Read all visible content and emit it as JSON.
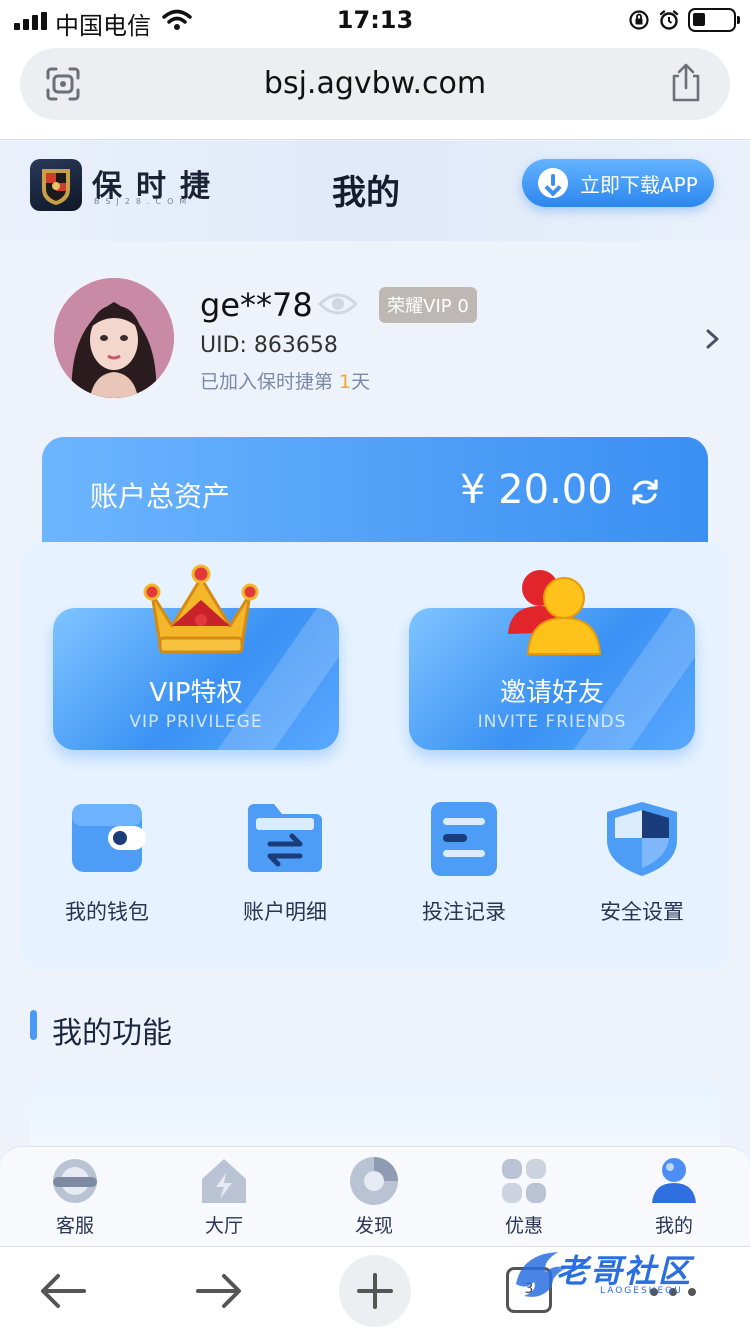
{
  "status_bar": {
    "carrier": "中国电信",
    "time": "17:13"
  },
  "browser": {
    "url": "bsj.agvbw.com"
  },
  "site_header": {
    "brand": "保时捷",
    "brand_sub": "BSJ28.COM",
    "title": "我的",
    "download_label": "立即下载APP"
  },
  "profile": {
    "username": "ge**78",
    "vip_badge": "荣耀VIP 0",
    "uid": "UID: 863658",
    "joined_prefix": "已加入保时捷第 ",
    "joined_days": "1",
    "joined_suffix": "天"
  },
  "assets": {
    "label": "账户总资产",
    "amount": "¥ 20.00"
  },
  "features": [
    {
      "title": "VIP特权",
      "subtitle": "VIP PRIVILEGE"
    },
    {
      "title": "邀请好友",
      "subtitle": "INVITE FRIENDS"
    }
  ],
  "quick_actions": [
    {
      "label": "我的钱包",
      "icon": "wallet-icon"
    },
    {
      "label": "账户明细",
      "icon": "folder-transfer-icon"
    },
    {
      "label": "投注记录",
      "icon": "records-icon"
    },
    {
      "label": "安全设置",
      "icon": "shield-icon"
    }
  ],
  "section": {
    "title": "我的功能"
  },
  "tabbar": [
    {
      "label": "客服",
      "icon": "headset-icon"
    },
    {
      "label": "大厅",
      "icon": "home-icon"
    },
    {
      "label": "发现",
      "icon": "discover-icon"
    },
    {
      "label": "优惠",
      "icon": "gift-icon"
    },
    {
      "label": "我的",
      "icon": "user-icon",
      "active": true
    }
  ],
  "browser_toolbar": {
    "tab_count": "3"
  },
  "watermark": {
    "text": "老哥社区",
    "sub": "LAOGESHEQU"
  },
  "colors": {
    "accent": "#3a8ff2",
    "panel": "#e6f2ff",
    "vip_badge": "#bdb8b3",
    "highlight": "#f5a623"
  }
}
